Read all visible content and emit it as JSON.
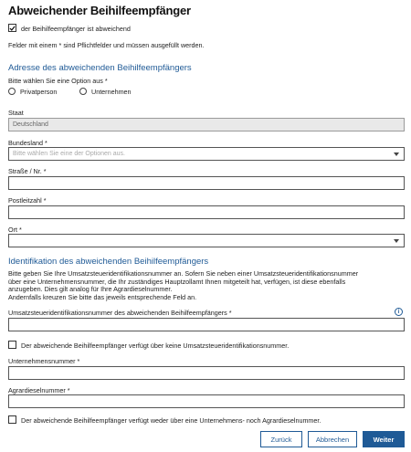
{
  "page": {
    "title": "Abweichender Beihilfeempfänger",
    "deviating_checkbox_label": "der Beihilfeempfänger ist abweichend",
    "required_note": "Felder mit einem * sind Pflichtfelder und müssen ausgefüllt werden."
  },
  "address": {
    "heading": "Adresse des abweichenden Beihilfeempfängers",
    "option_prompt": "Bitte wählen Sie eine Option aus *",
    "option_private": "Privatperson",
    "option_company": "Unternehmen",
    "country_label": "Staat",
    "country_value": "Deutschland",
    "state_label": "Bundesland *",
    "state_placeholder": "Bitte wählen Sie eine der Optionen aus.",
    "street_label": "Straße / Nr. *",
    "postcode_label": "Postleitzahl *",
    "city_label": "Ort *"
  },
  "identification": {
    "heading": "Identifikation des abweichenden Beihilfeempfängers",
    "intro_line1": "Bitte geben Sie Ihre Umsatzsteueridentifikationsnummer an. Sofern Sie neben einer Umsatzsteueridentifikationsnummer",
    "intro_line2": "über eine Unternehmensnummer, die Ihr zuständiges Hauptzollamt Ihnen mitgeteilt hat, verfügen, ist diese ebenfalls",
    "intro_line3": "anzugeben. Dies gilt analog für Ihre Agrardieselnummer.",
    "intro_line4": "Andernfalls kreuzen Sie bitte das jeweils entsprechende Feld an.",
    "vat_label": "Umsatzsteueridentifikationsnummer des abweichenden Beihilfeempfängers *",
    "no_vat_label": "Der abweichende Beihilfeempfänger verfügt über keine Umsatzsteueridentifikationsnummer.",
    "company_number_label": "Unternehmensnummer *",
    "agrar_label": "Agrardieselnummer *",
    "no_numbers_label": "Der abweichende Beihilfeempfänger verfügt weder über eine Unternehmens- noch Agrardieselnummer."
  },
  "buttons": {
    "back": "Zurück",
    "cancel": "Abbrechen",
    "next": "Weiter"
  },
  "colors": {
    "accent": "#1f5a96"
  }
}
